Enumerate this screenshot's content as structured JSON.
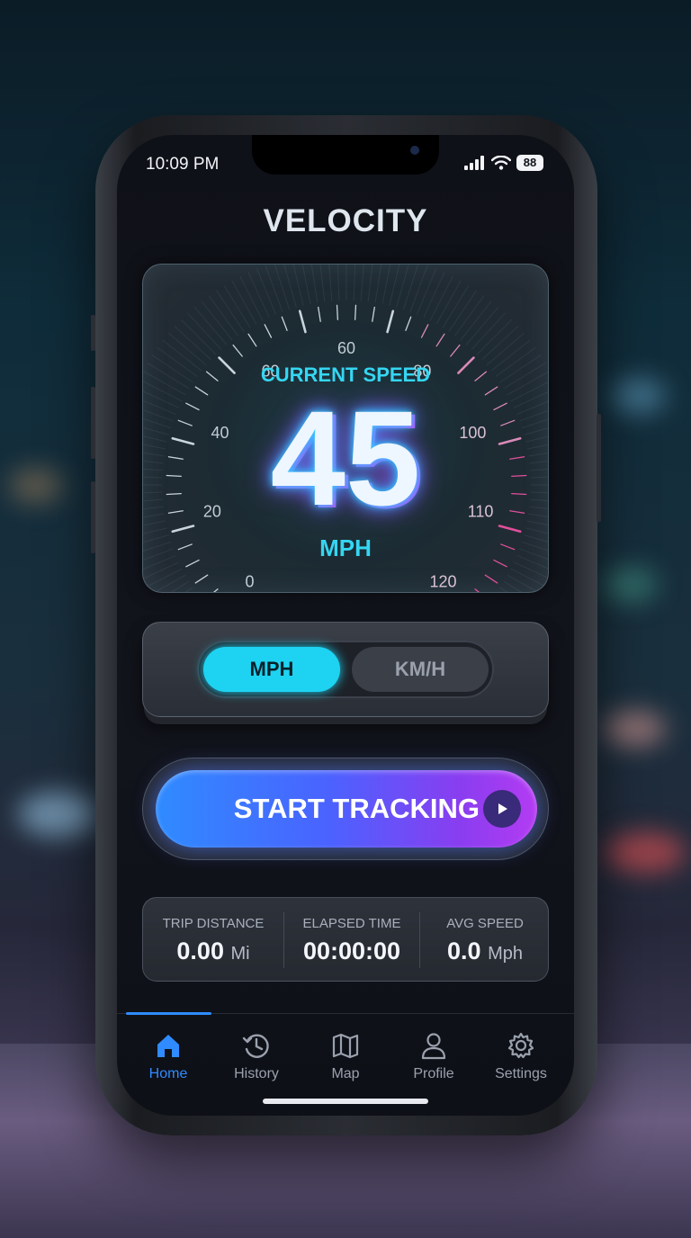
{
  "status_bar": {
    "time": "10:09 PM",
    "battery": "88"
  },
  "app": {
    "title": "VELOCITY"
  },
  "speedometer": {
    "label": "CURRENT SPEED",
    "speed": "45",
    "unit": "MPH",
    "tick_labels": [
      "0",
      "20",
      "40",
      "60",
      "60",
      "80",
      "100",
      "110",
      "120"
    ]
  },
  "unit_toggle": {
    "options": [
      "MPH",
      "KM/H"
    ],
    "selected": "MPH"
  },
  "start_button": {
    "label": "START TRACKING",
    "icon": "play-icon"
  },
  "stats": [
    {
      "label": "TRIP DISTANCE",
      "value": "0.00",
      "unit": "Mi"
    },
    {
      "label": "ELAPSED TIME",
      "value": "00:00:00",
      "unit": ""
    },
    {
      "label": "AVG SPEED",
      "value": "0.0",
      "unit": "Mph"
    }
  ],
  "nav": {
    "items": [
      {
        "label": "Home",
        "icon": "home-icon"
      },
      {
        "label": "History",
        "icon": "history-icon"
      },
      {
        "label": "Map",
        "icon": "map-icon"
      },
      {
        "label": "Profile",
        "icon": "profile-icon"
      },
      {
        "label": "Settings",
        "icon": "settings-icon"
      }
    ],
    "active": "Home"
  },
  "colors": {
    "accent_cyan": "#1ed3f2",
    "accent_blue": "#2f8bff",
    "accent_purple": "#b43cf2",
    "gauge_pink": "#e0509a"
  }
}
